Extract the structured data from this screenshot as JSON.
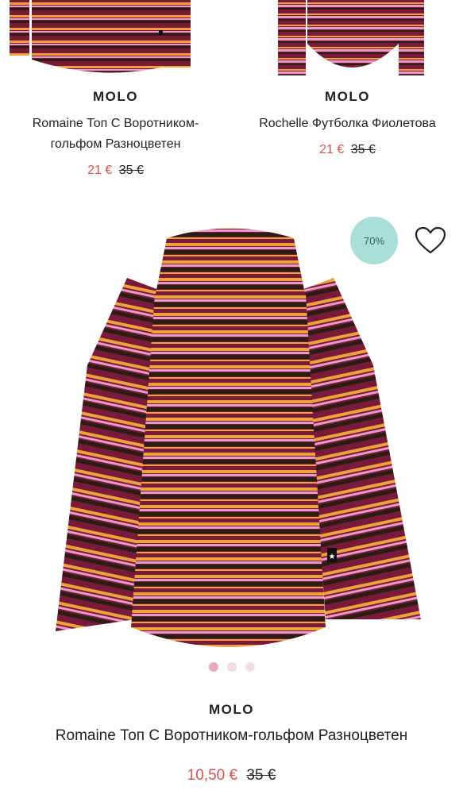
{
  "products_top": [
    {
      "brand": "MOLO",
      "title_line1": "Romaine Топ С Воротником-",
      "title_line2": "гольфом Разноцветен",
      "sale_price": "21 €",
      "old_price": "35 €"
    },
    {
      "brand": "MOLO",
      "title_line1": "Rochelle Футболка Фиолетова",
      "sale_price": "21 €",
      "old_price": "35 €"
    }
  ],
  "featured": {
    "discount": "70%",
    "brand": "MOLO",
    "title": "Romaine Топ С Воротником-гольфом Разноцветен",
    "sale_price": "10,50 €",
    "old_price": "35 €",
    "carousel_count": 3,
    "carousel_active": 1
  },
  "colors": {
    "sale": "#d9534f",
    "badge_bg": "#a8dfd6",
    "stripe_maroon": "#7a1a3a",
    "stripe_orange": "#f0a23a",
    "stripe_pink": "#e79bc8",
    "stripe_black": "#2a1d14"
  },
  "icons": [
    "heart-icon"
  ]
}
